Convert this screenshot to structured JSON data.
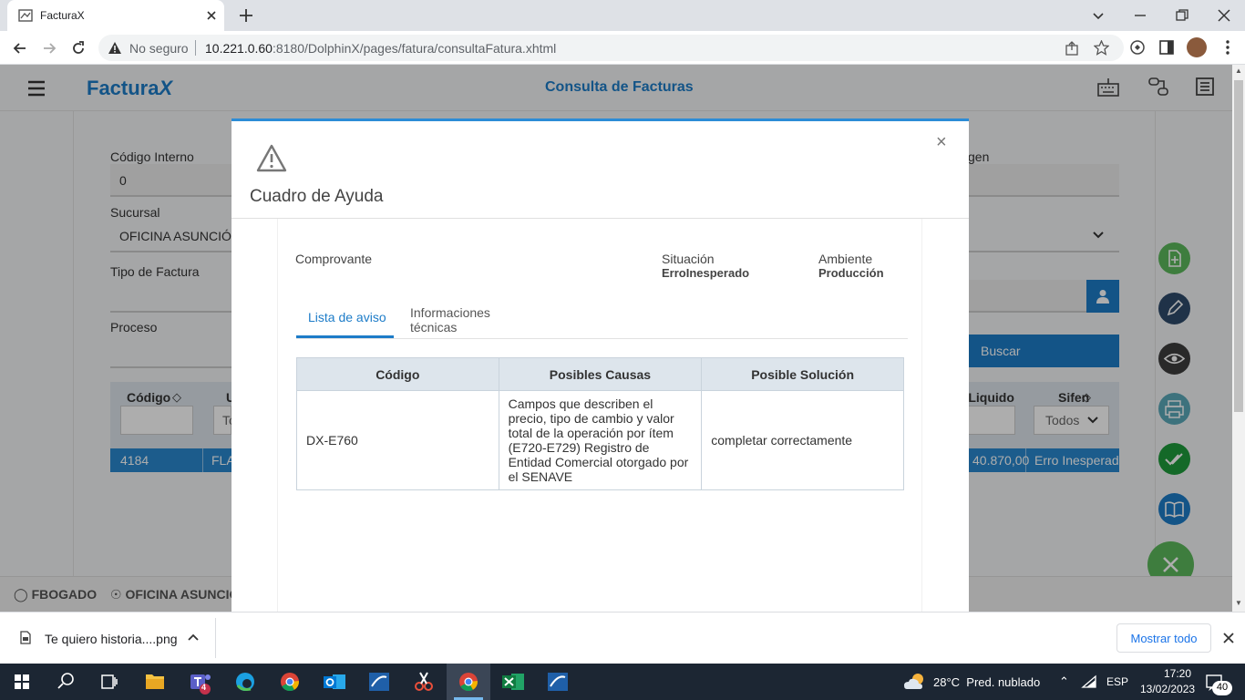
{
  "browser": {
    "tab_title": "FacturaX",
    "security_label": "No seguro",
    "url_host": "10.221.0.60",
    "url_rest": ":8180/DolphinX/pages/fatura/consultaFatura.xhtml"
  },
  "app": {
    "logo_text": "Factura",
    "logo_x": "X",
    "page_title": "Consulta de Facturas",
    "form": {
      "codigo_interno_label": "Código Interno",
      "codigo_interno_value": "0",
      "sucursal_label": "Sucursal",
      "sucursal_value": "OFICINA ASUNCIÓ",
      "tipo_factura_label": "Tipo de Factura",
      "proceso_label": "Proceso",
      "origen_label_partial": "gen",
      "buscar_label": "Buscar"
    },
    "grid": {
      "col_codigo": "Código",
      "col_u_partial": "U",
      "col_liquido_partial": "r Liquido",
      "col_sifen": "Sifen",
      "filter_to_partial": "To",
      "filter_todos": "Todos",
      "row": {
        "codigo": "4184",
        "u_partial": "FLA",
        "liquido_partial": "40.870,00",
        "sifen_partial": "Erro Inesperad"
      }
    },
    "footer": {
      "user": "FBOGADO",
      "branch": "OFICINA ASUNCIÓ"
    }
  },
  "modal": {
    "title": "Cuadro de Ayuda",
    "close_glyph": "×",
    "comprovante_label": "Comprovante",
    "situacion_label": "Situación",
    "situacion_value": "ErroInesperado",
    "ambiente_label": "Ambiente",
    "ambiente_value": "Producción",
    "tabs": [
      "Lista de aviso",
      "Informaciones técnicas"
    ],
    "table": {
      "headers": [
        "Código",
        "Posibles Causas",
        "Posible Solución"
      ],
      "rows": [
        {
          "codigo": "DX-E760",
          "causas": "Campos que describen el precio, tipo de cambio y valor total de la operación por ítem (E720-E729) Registro de Entidad Comercial otorgado por el SENAVE",
          "solucion": "completar correctamente"
        }
      ]
    }
  },
  "downloads": {
    "file_name": "Te quiero historia....png",
    "show_all": "Mostrar todo"
  },
  "taskbar": {
    "weather": "28°C  Pred. nublado",
    "lang": "ESP",
    "time": "17:20",
    "date": "13/02/2023",
    "notif_count": "40",
    "teams_badge": "4"
  },
  "colors": {
    "accent_blue": "#1d7cc8",
    "modal_border": "#2c8cd6",
    "selected_row": "#2a88cf",
    "green": "#5cb85c",
    "dark_green": "#1e9b3b"
  }
}
